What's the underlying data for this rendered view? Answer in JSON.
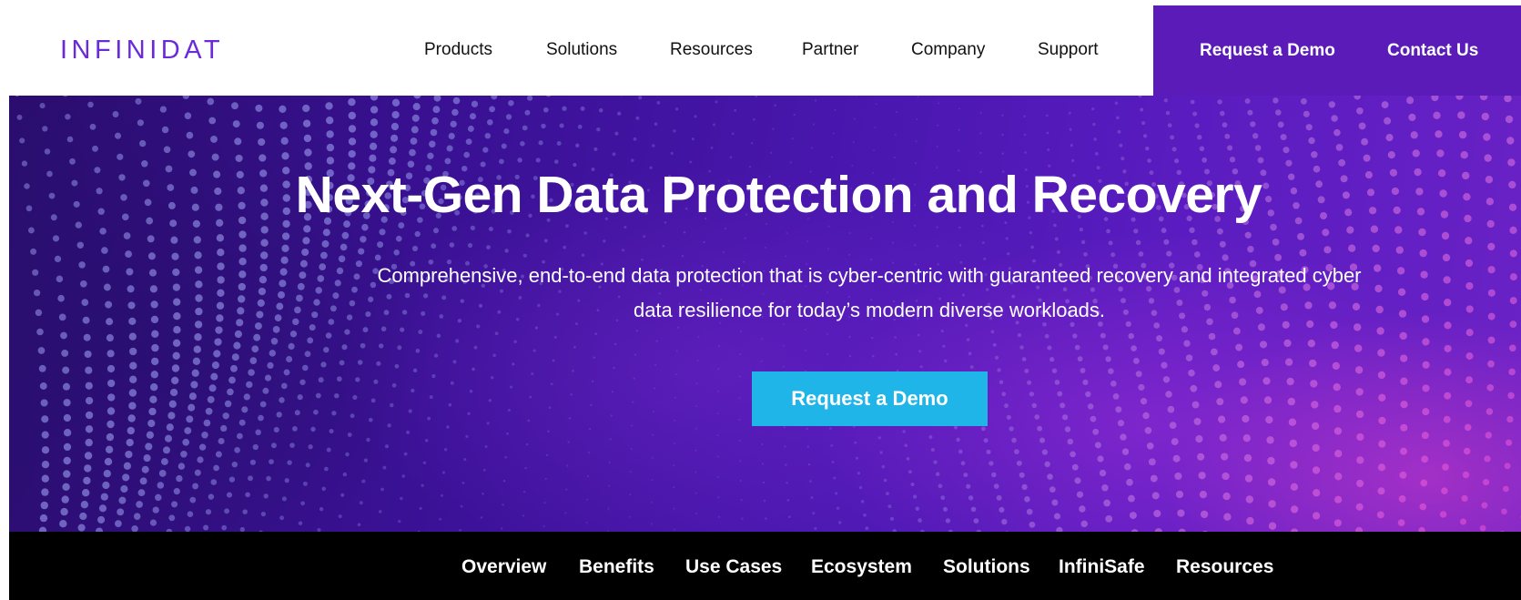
{
  "brand": {
    "logo_text": "INFINIDAT",
    "logo_color": "#6a2bd8",
    "accent_purple": "#5a1bb9",
    "cta_blue": "#1fb5e8"
  },
  "header": {
    "nav": [
      {
        "label": "Products"
      },
      {
        "label": "Solutions"
      },
      {
        "label": "Resources"
      },
      {
        "label": "Partner"
      },
      {
        "label": "Company"
      },
      {
        "label": "Support"
      }
    ],
    "cta": {
      "demo_label": "Request a Demo",
      "contact_label": "Contact Us"
    }
  },
  "hero": {
    "title": "Next-Gen Data Protection and Recovery",
    "subtitle": "Comprehensive, end-to-end data protection that is cyber-centric with guaranteed recovery and integrated cyber data resilience for today’s modern diverse workloads.",
    "button_label": "Request a Demo"
  },
  "subnav": {
    "items": [
      {
        "label": "Overview"
      },
      {
        "label": "Benefits"
      },
      {
        "label": "Use Cases"
      },
      {
        "label": "Ecosystem"
      },
      {
        "label": "Solutions"
      },
      {
        "label": "InfiniSafe"
      },
      {
        "label": "Resources"
      }
    ]
  }
}
